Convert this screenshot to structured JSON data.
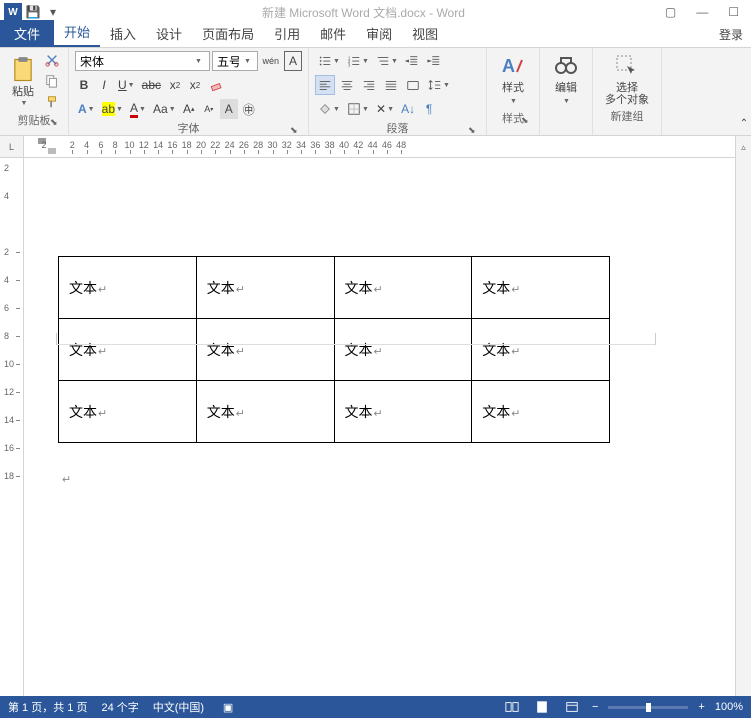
{
  "title_bar": {
    "doc_title": "新建 Microsoft Word 文档.docx - Word"
  },
  "tabs": {
    "file": "文件",
    "items": [
      "开始",
      "插入",
      "设计",
      "页面布局",
      "引用",
      "邮件",
      "审阅",
      "视图"
    ],
    "active_index": 0,
    "login": "登录"
  },
  "ribbon": {
    "clipboard": {
      "label": "剪贴板",
      "paste": "粘贴"
    },
    "font": {
      "label": "字体",
      "name": "宋体",
      "size": "五号"
    },
    "paragraph": {
      "label": "段落"
    },
    "styles": {
      "label": "样式",
      "btn": "样式"
    },
    "editing": {
      "label": "",
      "btn": "编辑"
    },
    "newgroup": {
      "label": "新建组",
      "btn": "选择\n多个对象"
    }
  },
  "ruler": {
    "h_marks": [
      2,
      4,
      6,
      8,
      10,
      12,
      14,
      16,
      18,
      20,
      22,
      24,
      26,
      28,
      30,
      32,
      34,
      36,
      38,
      40,
      42,
      44,
      46,
      48
    ],
    "v_marks": [
      2,
      4,
      6,
      8,
      10,
      12,
      14,
      16,
      18
    ],
    "v_neg": [
      2,
      4
    ]
  },
  "document": {
    "table": {
      "rows": 3,
      "cols": 4,
      "cell_text": "文本"
    }
  },
  "status": {
    "page": "第 1 页，共 1 页",
    "words": "24 个字",
    "lang": "中文(中国)",
    "zoom": "100%"
  }
}
